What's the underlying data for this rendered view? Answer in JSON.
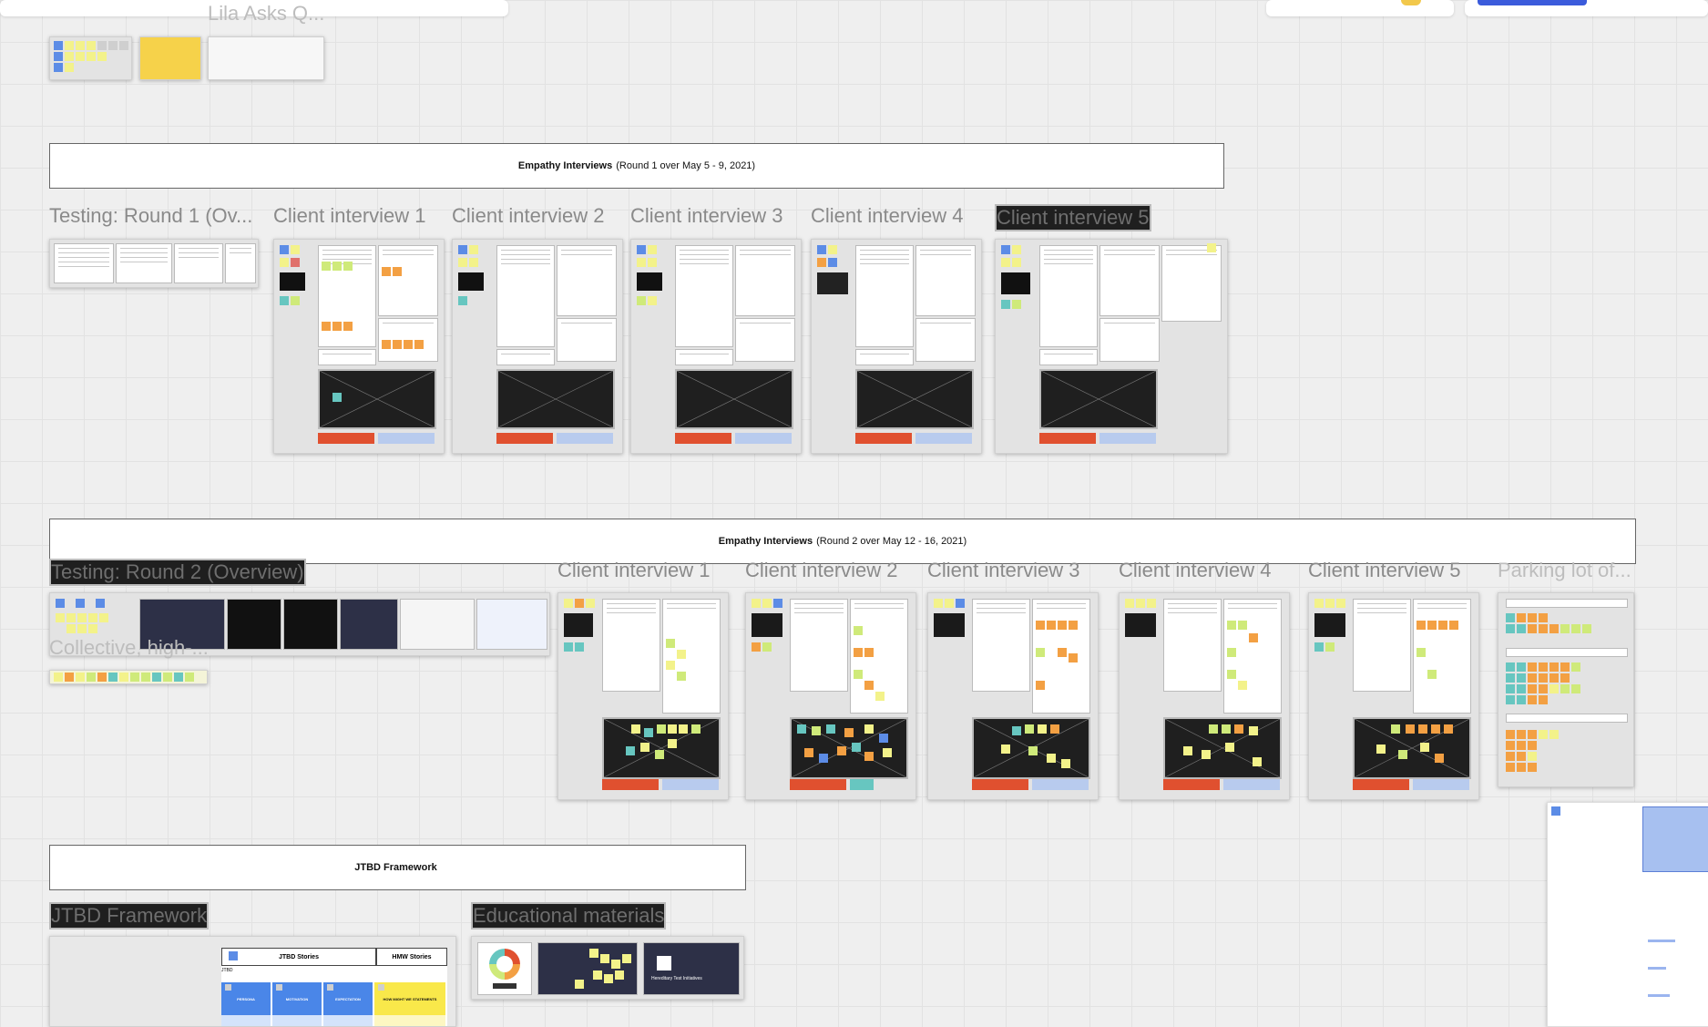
{
  "top": {
    "board_name": "Lila Asks Q..."
  },
  "banners": {
    "round1": {
      "bold": "Empathy Interviews",
      "rest": "(Round 1 over May 5 - 9, 2021)"
    },
    "round2": {
      "bold": "Empathy Interviews",
      "rest": "(Round 2 over May 12 - 16, 2021)"
    },
    "jtbd": {
      "bold": "JTBD Framework",
      "rest": ""
    }
  },
  "round1_frames": [
    "Testing: Round 1 (Ov...",
    "Client interview 1",
    "Client interview 2",
    "Client interview 3",
    "Client interview 4",
    "Client interview 5"
  ],
  "round2_frames": [
    "Testing: Round 2 (Overview)",
    "Client interview 1",
    "Client interview 2",
    "Client interview 3",
    "Client interview 4",
    "Client interview 5",
    "Parking lot of..."
  ],
  "collective_frame": "Collective, high-...",
  "jtbd_frame": "JTBD Framework",
  "educational_frame": "Educational materials",
  "jtbd_table": {
    "stories_header": "JTBD Stories",
    "hmw_header": "HMW Stories",
    "jtbd_label": "JTBD",
    "columns": [
      "PERSONA",
      "MOTIVATION",
      "EXPECTATION",
      "HOW MIGHT WE STATEMENTS"
    ]
  },
  "educational_thumbs": {
    "third_title": "Hereditary Test Initiatives"
  }
}
